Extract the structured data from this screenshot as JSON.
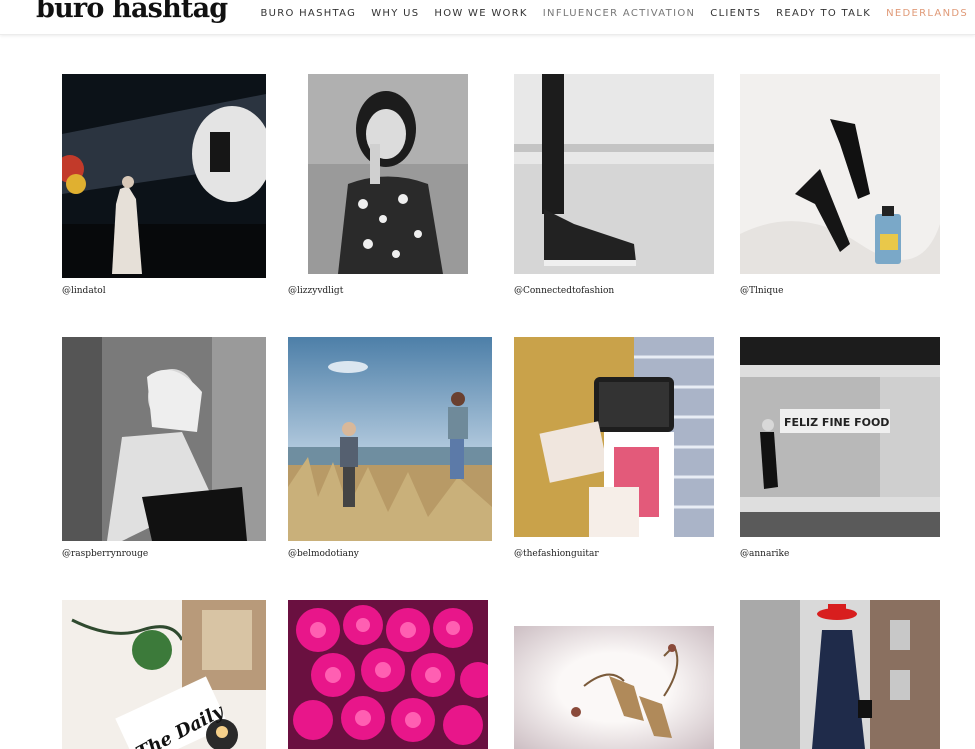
{
  "header": {
    "logo": "buro hashtag",
    "nav": [
      {
        "label": "BURO HASHTAG"
      },
      {
        "label": "WHY US"
      },
      {
        "label": "HOW WE WORK"
      },
      {
        "label": "INFLUENCER ACTIVATION"
      },
      {
        "label": "CLIENTS"
      },
      {
        "label": "READY TO TALK"
      },
      {
        "label": "NEDERLANDS"
      }
    ],
    "colors": {
      "text": "#333333",
      "active": "#777777",
      "language": "#e09a78"
    }
  },
  "gallery": [
    {
      "handle": "@lindatol",
      "subject": "runway show with figures in a white gown"
    },
    {
      "handle": "@lizzyvdligt",
      "subject": "black and white portrait in leopard print top"
    },
    {
      "handle": "@Connectedtofashion",
      "subject": "black jeans and black sneakers"
    },
    {
      "handle": "@Tlnique",
      "subject": "black heels and perfume bottle on white sheet"
    },
    {
      "handle": "@raspberrynrouge",
      "subject": "black and white portrait of seated woman"
    },
    {
      "handle": "@belmodotiany",
      "subject": "children on a beach with dune grass"
    },
    {
      "handle": "@thefashionguitar",
      "subject": "sequined bag and magazines flatlay"
    },
    {
      "handle": "@annarike",
      "subject": "woman walking past Feliz Fine Food storefront",
      "sign": "FELIZ FINE FOOD"
    },
    {
      "handle": "",
      "subject": "green flower, candle and The Daily newspaper",
      "sign": "The Daily"
    },
    {
      "handle": "",
      "subject": "bouquet of pink roses"
    },
    {
      "handle": "",
      "subject": "strappy heeled sandals with tassels"
    },
    {
      "handle": "",
      "subject": "woman in red hat and navy coat on street"
    }
  ]
}
